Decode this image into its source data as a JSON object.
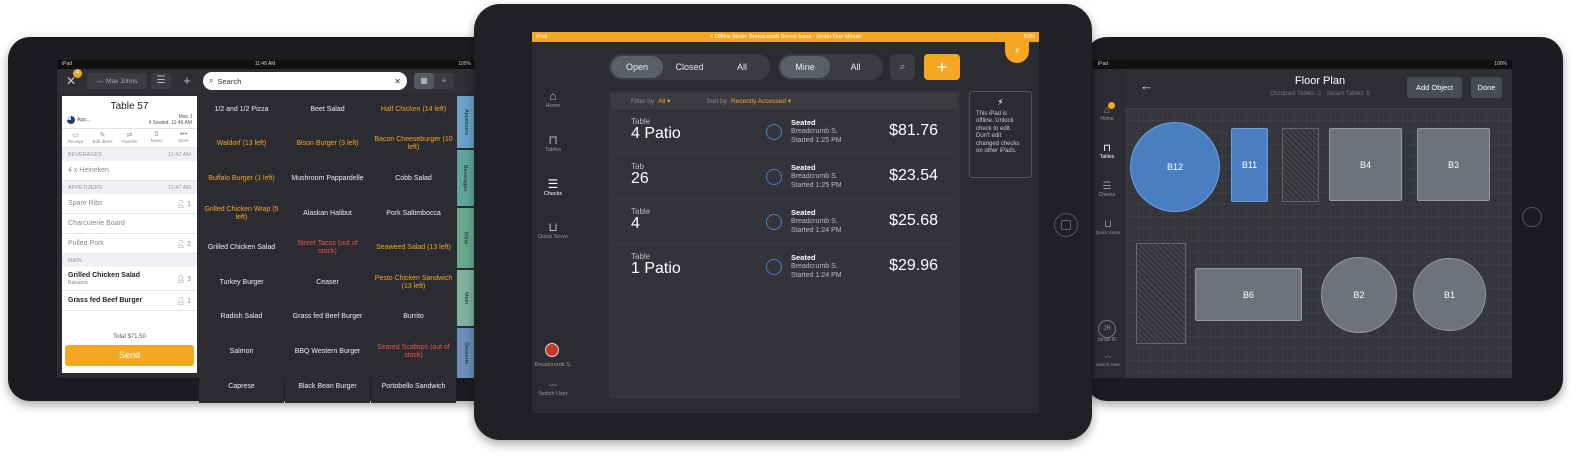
{
  "left": {
    "status": {
      "carrier": "iPad",
      "time": "11:48 AM",
      "battery": "100%"
    },
    "badge": "4",
    "server": "Max Johns",
    "search_placeholder": "Search",
    "ticket": {
      "title": "Table 57",
      "app_label": "App...",
      "server_short": "Max J",
      "seated": "4 Seated, 11:46 AM",
      "actions": [
        "Receipt",
        "Edit Items",
        "Transfer",
        "Notes",
        "More"
      ],
      "notes_count": "0",
      "sections": [
        {
          "name": "BEVERAGES",
          "time": "11:47 AM",
          "items": [
            {
              "name": "4 x Heineken",
              "seat": ""
            }
          ]
        },
        {
          "name": "APPETIZERS",
          "time": "11:47 AM",
          "items": [
            {
              "name": "Spare Ribs",
              "seat": "1"
            },
            {
              "name": "Charcuterie Board",
              "seat": ""
            },
            {
              "name": "Pulled Pork",
              "seat": "2"
            }
          ]
        },
        {
          "name": "MAIN",
          "time": "",
          "items": [
            {
              "name": "Grilled Chicken Salad",
              "sub": "Balsamic",
              "seat": "3"
            },
            {
              "name": "Grass fed Beef Burger",
              "seat": "1"
            }
          ]
        }
      ],
      "total": "Total $71.50",
      "send": "Send"
    },
    "menu": [
      [
        "1/2 and 1/2 Pizza",
        "",
        ""
      ],
      [
        "Beet Salad",
        "",
        ""
      ],
      [
        "Half Chicken (14 left)",
        "orange",
        ""
      ],
      [
        "Waldorf (13 left)",
        "orange",
        ""
      ],
      [
        "Bison Burger (3 left)",
        "orange",
        ""
      ],
      [
        "Bacon Cheeseburger (10 left)",
        "orange",
        ""
      ],
      [
        "Buffalo Burger (1 left)",
        "orange",
        ""
      ],
      [
        "Mushroom Pappardelle",
        "",
        ""
      ],
      [
        "Cobb Salad",
        "",
        ""
      ],
      [
        "Grilled Chicken Wrap (5 left)",
        "orange",
        ""
      ],
      [
        "Alaskan Halibut",
        "",
        ""
      ],
      [
        "Pork Saltimbocca",
        "",
        ""
      ],
      [
        "Grilled Chicken Salad",
        "",
        ""
      ],
      [
        "Street Tacos (out of stock)",
        "red",
        ""
      ],
      [
        "Seaweed Salad (13 left)",
        "orange",
        ""
      ],
      [
        "Turkey Burger",
        "",
        ""
      ],
      [
        "Ceaser",
        "",
        ""
      ],
      [
        "Pesto Chicken Sandwich (13 left)",
        "orange",
        ""
      ],
      [
        "Radish Salad",
        "",
        ""
      ],
      [
        "Grass fed Beef Burger",
        "",
        ""
      ],
      [
        "Burrito",
        "",
        ""
      ],
      [
        "Salmon",
        "",
        ""
      ],
      [
        "BBQ Western Burger",
        "",
        ""
      ],
      [
        "Seared Scallops (out of stock)",
        "red",
        ""
      ],
      [
        "Caprese",
        "",
        ""
      ],
      [
        "Black Bean Burger",
        "",
        ""
      ],
      [
        "Portobello Sandwich",
        "",
        ""
      ]
    ],
    "categories": [
      "Appetizers",
      "Beverages",
      "Wine",
      "Main",
      "Desserts"
    ],
    "category_colors": [
      "#6ba3c8",
      "#5fa6a0",
      "#6aa88c",
      "#7fb3a0",
      "#6b8fb8"
    ]
  },
  "center": {
    "status": {
      "carrier": "iPad",
      "banner": "Offline Mode: Breadcrumb Server Issue - Under One Minute",
      "battery": "53%"
    },
    "filters1": [
      "Open",
      "Closed",
      "All"
    ],
    "filters2": [
      "Mine",
      "All"
    ],
    "filter_by_label": "Filter by",
    "filter_by_value": "All",
    "sort_by_label": "Sort by",
    "sort_by_value": "Recently Accessed",
    "nav": [
      "Home",
      "Tables",
      "Checks",
      "Quick Serve"
    ],
    "user": "Breadcrumb S.",
    "switch_user": "Switch User",
    "offline_note": "This iPad is offline. Unlock check to edit. Don't edit changed checks on other iPads.",
    "checks": [
      {
        "type": "Table",
        "name": "4 Patio",
        "status": "Seated",
        "server": "Breadcrumb S.",
        "time": "Started 1:25 PM",
        "amount": "$81.76"
      },
      {
        "type": "Tab",
        "name": "26",
        "status": "Seated",
        "server": "Breadcrumb S.",
        "time": "Started 1:25 PM",
        "amount": "$23.54"
      },
      {
        "type": "Table",
        "name": "4",
        "status": "Seated",
        "server": "Breadcrumb S.",
        "time": "Started 1:24 PM",
        "amount": "$25.68"
      },
      {
        "type": "Table",
        "name": "1 Patio",
        "status": "Seated",
        "server": "Breadcrumb S.",
        "time": "Started 1:24 PM",
        "amount": "$29.96"
      }
    ],
    "accent": "#f5a623"
  },
  "right": {
    "status": {
      "carrier": "iPad",
      "battery": "100%"
    },
    "title": "Floor Plan",
    "subtitle": "Occupied Tables: 2   Vacant Tables: 6",
    "add_object": "Add Object",
    "done": "Done",
    "nav": [
      "Home",
      "Tables",
      "Checks",
      "Quick Serve"
    ],
    "user_initials": "JR",
    "user": "Jonah R.",
    "switch_user": "Switch User",
    "tables": [
      "B12",
      "B11",
      "B4",
      "B3",
      "B6",
      "B2",
      "B1"
    ]
  }
}
